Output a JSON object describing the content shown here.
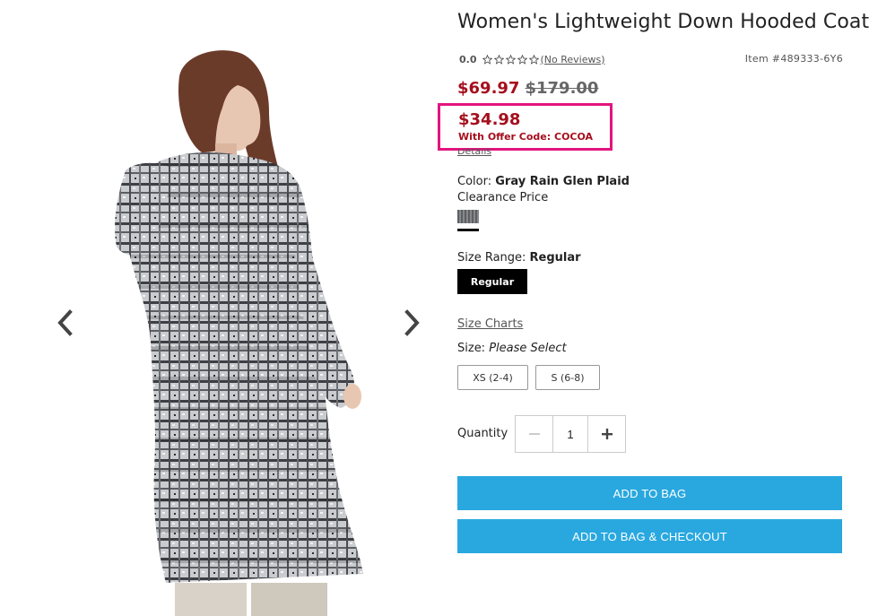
{
  "product": {
    "title": "Women's Lightweight Down Hooded Coat",
    "rating_value": "0.0",
    "reviews_link": "(No Reviews)",
    "item_number": "Item #489333-6Y6",
    "sale_price": "$69.97",
    "original_price": "$179.00",
    "offer_price": "$34.98",
    "offer_code_text": "With Offer Code: COCOA",
    "details_link": "Details",
    "color_label": "Color:",
    "color_value": "Gray Rain Glen Plaid",
    "clearance_text": "Clearance Price",
    "size_range_label": "Size Range:",
    "size_range_value": "Regular",
    "size_range_button": "Regular",
    "size_charts_link": "Size Charts",
    "size_label": "Size:",
    "size_value": "Please Select",
    "size_options": [
      "XS (2-4)",
      "S (6-8)"
    ],
    "quantity_label": "Quantity",
    "quantity_value": "1",
    "add_to_bag": "ADD TO BAG",
    "add_to_bag_checkout": "ADD TO BAG & CHECKOUT",
    "rating_stars": 0
  },
  "colors": {
    "price_red": "#a50f1d",
    "highlight_pink": "#e3147e",
    "button_blue": "#29a8df"
  },
  "icons": {
    "prev": "chevron-left-icon",
    "next": "chevron-right-icon",
    "star": "star-outline-icon",
    "minus": "minus-icon",
    "plus": "plus-icon"
  }
}
